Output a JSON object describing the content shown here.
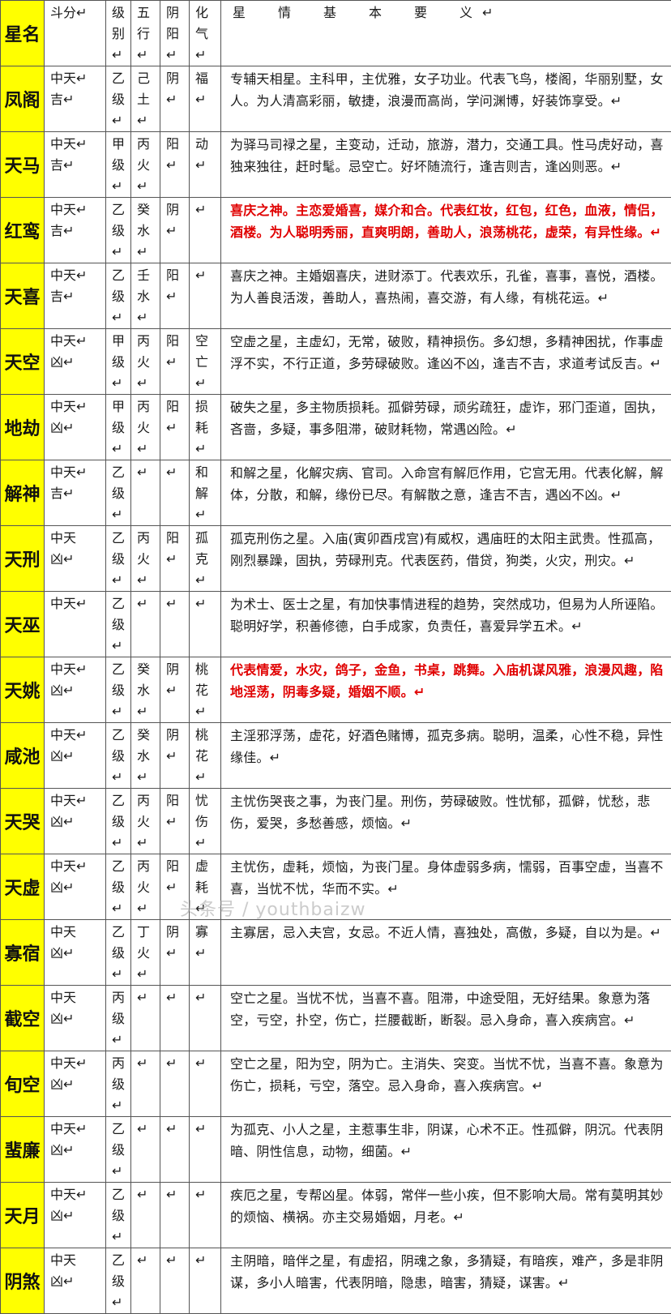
{
  "header": {
    "name": "星名",
    "grade": "斗分↵",
    "level": "级\n别↵",
    "wuxing": "五\n行↵",
    "yinyang": "阴\n阳↵",
    "huaqi": "化\n气↵",
    "desc": "星　情　基　本　要　义↵"
  },
  "rows": [
    {
      "name": "凤阁",
      "grade": "中天↵\n吉↵",
      "level": "乙\n级↵",
      "wuxing": "己\n土↵",
      "yinyang": "阴↵",
      "huaqi": "福↵",
      "red": false,
      "desc": "专辅天相星。主科甲，主优雅，女子功业。代表飞鸟，楼阁，华丽别墅，女人。为人清高彩丽，敏捷，浪漫而高尚，学问渊博，好装饰享受。↵"
    },
    {
      "name": "天马",
      "grade": "中天↵\n吉↵",
      "level": "甲\n级↵",
      "wuxing": "丙\n火↵",
      "yinyang": "阳↵",
      "huaqi": "动↵",
      "red": false,
      "desc": "为驿马司禄之星，主变动，迁动，旅游，潜力，交通工具。性马虎好动，喜独来独往，赶时髦。忌空亡。好坏随流行，逢吉则吉，逢凶则恶。↵"
    },
    {
      "name": "红鸾",
      "grade": "中天↵\n吉↵",
      "level": "乙\n级↵",
      "wuxing": "癸\n水↵",
      "yinyang": "阴↵",
      "huaqi": "↵",
      "red": true,
      "desc": "喜庆之神。主恋爱婚喜，媒介和合。代表红妆，红包，红色，血液，情侣，酒楼。为人聪明秀丽，直爽明朗，善助人，浪荡桃花，虚荣，有异性缘。↵"
    },
    {
      "name": "天喜",
      "grade": "中天↵\n吉↵",
      "level": "乙\n级↵",
      "wuxing": "壬\n水↵",
      "yinyang": "阳↵",
      "huaqi": "↵",
      "red": false,
      "desc": "喜庆之神。主婚姻喜庆，进财添丁。代表欢乐，孔雀，喜事，喜悦，酒楼。为人善良活泼，善助人，喜热闹，喜交游，有人缘，有桃花运。↵"
    },
    {
      "name": "天空",
      "grade": "中天↵\n凶↵",
      "level": "甲\n级↵",
      "wuxing": "丙\n火↵",
      "yinyang": "阳↵",
      "huaqi": "空\n亡↵",
      "red": false,
      "desc": "空虚之星，主虚幻，无常，破败，精神损伤。多幻想，多精神困扰，作事虚浮不实，不行正道，多劳碌破败。逢凶不凶，逢吉不吉，求道考试反吉。↵"
    },
    {
      "name": "地劫",
      "grade": "中天↵\n凶↵",
      "level": "甲\n级↵",
      "wuxing": "丙\n火↵",
      "yinyang": "阳↵",
      "huaqi": "损\n耗↵",
      "red": false,
      "desc": "破失之星，多主物质损耗。孤僻劳碌，顽劣疏狂，虚诈，邪门歪道，固执，吝啬，多疑，事多阻滞，破财耗物，常遇凶险。↵"
    },
    {
      "name": "解神",
      "grade": "中天↵\n吉↵",
      "level": "乙\n级↵",
      "wuxing": "↵",
      "yinyang": "↵",
      "huaqi": "和\n解↵",
      "red": false,
      "desc": "和解之星，化解灾病、官司。入命宫有解厄作用，它宫无用。代表化解，解体，分散，和解，缘份已尽。有解散之意，逢吉不吉，遇凶不凶。↵"
    },
    {
      "name": "天刑",
      "grade": "中天\n凶↵",
      "level": "乙\n级↵",
      "wuxing": "丙\n火↵",
      "yinyang": "阳↵",
      "huaqi": "孤\n克↵",
      "red": false,
      "desc": "孤克刑伤之星。入庙(寅卯酉戌宫)有威权，遇庙旺的太阳主武贵。性孤高，刚烈暴躁，固执，劳碌刑克。代表医药，借贷，狗类，火灾，刑灾。↵"
    },
    {
      "name": "天巫",
      "grade": "中天↵",
      "level": "乙\n级↵",
      "wuxing": "↵",
      "yinyang": "↵",
      "huaqi": "↵",
      "red": false,
      "desc": "为术士、医士之星，有加快事情进程的趋势，突然成功，但易为人所诬陷。聪明好学，积善修德，白手成家，负责任，喜爱异学五术。↵"
    },
    {
      "name": "天姚",
      "grade": "中天↵\n凶↵",
      "level": "乙\n级↵",
      "wuxing": "癸\n水↵",
      "yinyang": "阴↵",
      "huaqi": "桃\n花↵",
      "red": true,
      "desc": "代表情爱，水灾，鸽子，金鱼，书桌，跳舞。入庙机谋风雅，浪漫风趣，陷地淫荡，阴毒多疑，婚姻不顺。↵"
    },
    {
      "name": "咸池",
      "grade": "中天↵\n凶↵",
      "level": "乙\n级↵",
      "wuxing": "癸\n水↵",
      "yinyang": "阴↵",
      "huaqi": "桃\n花↵",
      "red": false,
      "desc": "主淫邪浮荡，虚花，好酒色赌博，孤克多病。聪明，温柔，心性不稳，异性缘佳。↵"
    },
    {
      "name": "天哭",
      "grade": "中天↵\n凶↵",
      "level": "乙\n级↵",
      "wuxing": "丙\n火↵",
      "yinyang": "阳↵",
      "huaqi": "忧\n伤↵",
      "red": false,
      "desc": "主忧伤哭丧之事，为丧门星。刑伤，劳碌破败。性忧郁，孤僻，忧愁，悲伤，爱哭，多愁善感，烦恼。↵"
    },
    {
      "name": "天虚",
      "grade": "中天↵\n凶↵",
      "level": "乙\n级↵",
      "wuxing": "丙\n火↵",
      "yinyang": "阳↵",
      "huaqi": "虚\n耗↵",
      "red": false,
      "desc": "主忧伤，虚耗，烦恼，为丧门星。身体虚弱多病，懦弱，百事空虚，当喜不喜，当忧不忧，华而不实。↵"
    },
    {
      "name": "寡宿",
      "grade": "中天\n凶↵",
      "level": "乙\n级↵",
      "wuxing": "丁\n火↵",
      "yinyang": "阴↵",
      "huaqi": "寡↵",
      "red": false,
      "desc": "主寡居，忌入夫宫，女忌。不近人情，喜独处，高傲，多疑，自以为是。↵"
    },
    {
      "name": "截空",
      "grade": "中天\n凶↵",
      "level": "丙\n级↵",
      "wuxing": "↵",
      "yinyang": "↵",
      "huaqi": "↵",
      "red": false,
      "desc": "空亡之星。当忧不忧，当喜不喜。阻滞，中途受阻，无好结果。象意为落空，亏空，扑空，伤亡，拦腰截断，断裂。忌入身命，喜入疾病宫。↵"
    },
    {
      "name": "旬空",
      "grade": "中天↵\n凶↵",
      "level": "丙\n级↵",
      "wuxing": "↵",
      "yinyang": "↵",
      "huaqi": "↵",
      "red": false,
      "desc": "空亡之星，阳为空，阴为亡。主消失、突变。当忧不忧，当喜不喜。象意为伤亡，损耗，亏空，落空。忌入身命，喜入疾病宫。↵"
    },
    {
      "name": "蜚廉",
      "grade": "中天↵\n凶↵",
      "level": "乙\n级↵",
      "wuxing": "↵",
      "yinyang": "↵",
      "huaqi": "↵",
      "red": false,
      "desc": "为孤克、小人之星，主惹事生非，阴谋，心术不正。性孤僻，阴沉。代表阴暗、阴性信息，动物，细菌。↵"
    },
    {
      "name": "天月",
      "grade": "中天↵\n凶↵",
      "level": "乙\n级↵",
      "wuxing": "↵",
      "yinyang": "↵",
      "huaqi": "↵",
      "red": false,
      "desc": "疾厄之星，专帮凶星。体弱，常伴一些小疾，但不影响大局。常有莫明其妙的烦恼、横祸。亦主交易婚姻，月老。↵"
    },
    {
      "name": "阴煞",
      "grade": "中天\n凶↵",
      "level": "乙\n级↵",
      "wuxing": "↵",
      "yinyang": "↵",
      "huaqi": "↵",
      "red": false,
      "desc": "主阴暗，暗伴之星，有虚招，阴魂之象，多猜疑，有暗疾，难产，多是非阴谋，多小人暗害，代表阴暗，隐患，暗害，猜疑，谋害。↵"
    }
  ],
  "watermark": "头条号 / youthbaizw"
}
